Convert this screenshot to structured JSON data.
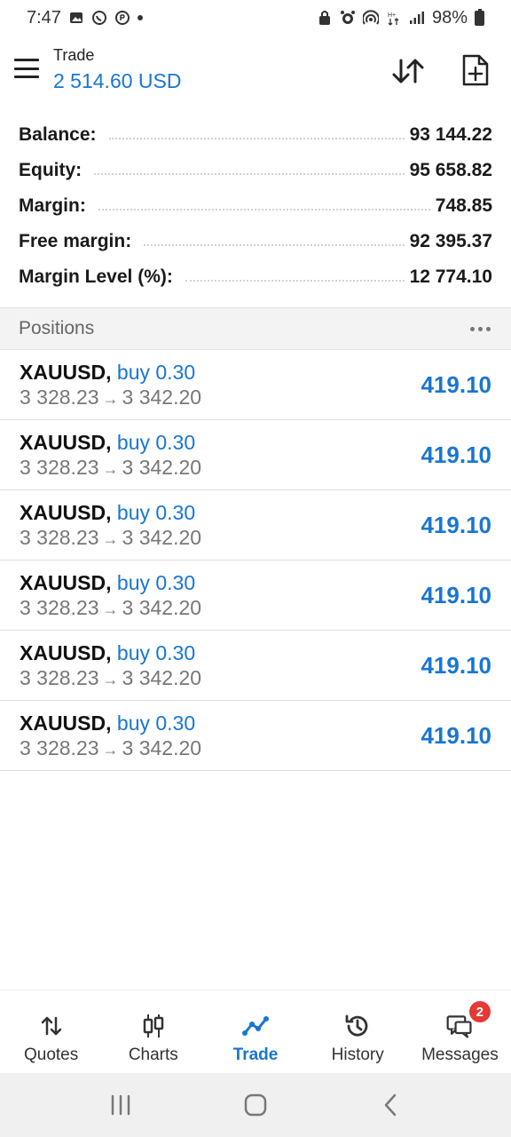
{
  "status_bar": {
    "time": "7:47",
    "battery": "98%",
    "icons_left": [
      "gallery-icon",
      "whatsapp-icon",
      "whatsapp-business-icon",
      "dot-icon"
    ],
    "icons_right": [
      "lock-icon",
      "alarm-icon",
      "hotspot-icon",
      "data-icon",
      "signal-icon",
      "battery-icon"
    ]
  },
  "header": {
    "title": "Trade",
    "balance": "2 514.60 USD",
    "icons": [
      "menu-icon",
      "sort-icon",
      "new-order-icon"
    ]
  },
  "summary": [
    {
      "label": "Balance:",
      "value": "93 144.22"
    },
    {
      "label": "Equity:",
      "value": "95 658.82"
    },
    {
      "label": "Margin:",
      "value": "748.85"
    },
    {
      "label": "Free margin:",
      "value": "92 395.37"
    },
    {
      "label": "Margin Level (%):",
      "value": "12 774.10"
    }
  ],
  "positions": {
    "title": "Positions",
    "rows": [
      {
        "symbol": "XAUUSD,",
        "type": "buy 0.30",
        "open": "3 328.23",
        "arrow": "→",
        "current": "3 342.20",
        "profit": "419.10"
      },
      {
        "symbol": "XAUUSD,",
        "type": "buy 0.30",
        "open": "3 328.23",
        "arrow": "→",
        "current": "3 342.20",
        "profit": "419.10"
      },
      {
        "symbol": "XAUUSD,",
        "type": "buy 0.30",
        "open": "3 328.23",
        "arrow": "→",
        "current": "3 342.20",
        "profit": "419.10"
      },
      {
        "symbol": "XAUUSD,",
        "type": "buy 0.30",
        "open": "3 328.23",
        "arrow": "→",
        "current": "3 342.20",
        "profit": "419.10"
      },
      {
        "symbol": "XAUUSD,",
        "type": "buy 0.30",
        "open": "3 328.23",
        "arrow": "→",
        "current": "3 342.20",
        "profit": "419.10"
      },
      {
        "symbol": "XAUUSD,",
        "type": "buy 0.30",
        "open": "3 328.23",
        "arrow": "→",
        "current": "3 342.20",
        "profit": "419.10"
      }
    ]
  },
  "bottom_nav": {
    "items": [
      {
        "label": "Quotes",
        "icon": "quotes-icon"
      },
      {
        "label": "Charts",
        "icon": "charts-icon"
      },
      {
        "label": "Trade",
        "icon": "trade-icon",
        "active": true
      },
      {
        "label": "History",
        "icon": "history-icon"
      },
      {
        "label": "Messages",
        "icon": "messages-icon",
        "badge": "2"
      }
    ]
  },
  "colors": {
    "accent": "#1976d2",
    "badge": "#e53935",
    "muted_text": "#777777"
  }
}
